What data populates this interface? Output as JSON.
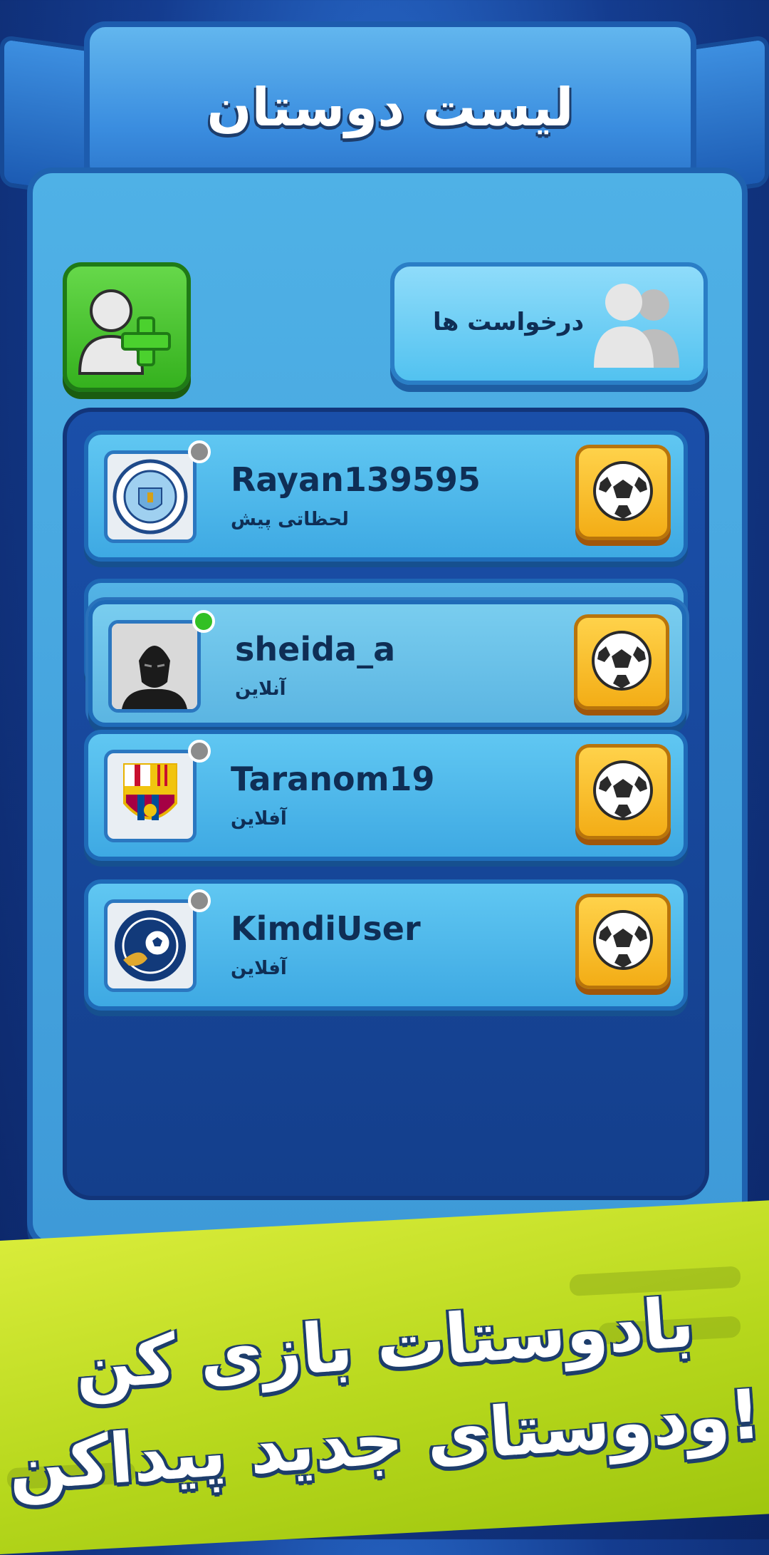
{
  "header": {
    "title": "لیست دوستان"
  },
  "actions": {
    "requests_label": "درخواست ها"
  },
  "friends": [
    {
      "username": "Rayan139595",
      "status": "لحظاتی پیش",
      "online": false,
      "avatar": "manchester-city-crest-icon"
    },
    {
      "username": "sheida_a",
      "status": "آنلاین",
      "online": true,
      "avatar": "black-panther-avatar-icon"
    },
    {
      "username": "Taranom19",
      "status": "آفلاین",
      "online": false,
      "avatar": "barcelona-crest-icon"
    },
    {
      "username": "KimdiUser",
      "status": "آفلاین",
      "online": false,
      "avatar": "football-league-crest-icon"
    }
  ],
  "promo": {
    "line1": "بادوستات بازی کن",
    "line2": "ودوستای جدید پیداکن!"
  },
  "colors": {
    "accent_green": "#35b11e",
    "accent_yellow": "#f3ad16",
    "panel_blue": "#3e9ad8",
    "promo_yellow": "#c6e02a"
  }
}
